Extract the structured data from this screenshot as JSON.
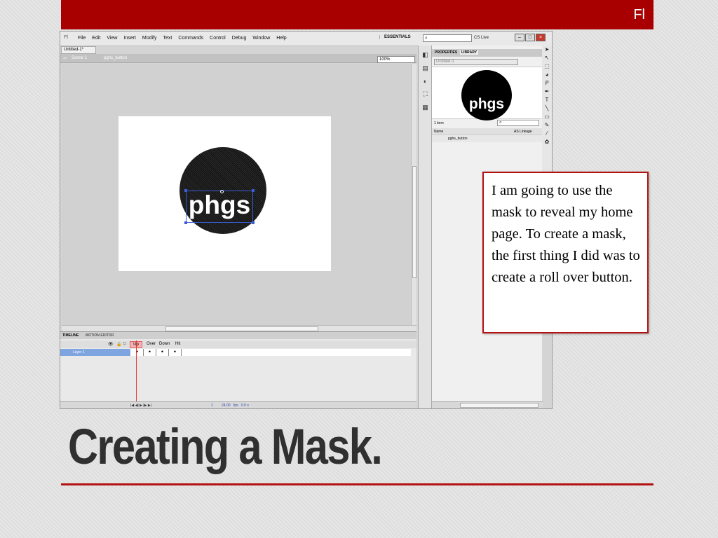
{
  "slide": {
    "corner_label": "Fl",
    "title": "Creating a Mask.",
    "note": "I am going to use the mask to reveal my home page. To create a mask, the first thing I did was to create a roll over button.",
    "accent": "#a80000"
  },
  "app": {
    "logo": "Fl",
    "menus": [
      "File",
      "Edit",
      "View",
      "Insert",
      "Modify",
      "Text",
      "Commands",
      "Control",
      "Debug",
      "Window",
      "Help"
    ],
    "workspace": "ESSENTIALS",
    "search_placeholder": "⌕",
    "cs_live": "CS Live",
    "doc_tab": "Untitled-1*",
    "breadcrumb": {
      "scene": "Scene 1",
      "symbol": "pghs_button"
    },
    "zoom": "100%",
    "stage_text": "phgs"
  },
  "timeline": {
    "tabs": [
      "TIMELINE",
      "MOTION EDITOR"
    ],
    "frames": [
      "Up",
      "Over",
      "Down",
      "Hit"
    ],
    "layer": "Layer 1",
    "fps": "24.00",
    "fps_unit": "fps",
    "time": "0.0 s",
    "frame_num": "1"
  },
  "library": {
    "tabs": [
      "PROPERTIES",
      "LIBRARY"
    ],
    "document": "Untitled-1",
    "preview_text": "phgs",
    "count": "1 item",
    "col_name": "Name",
    "col_linkage": "AS Linkage",
    "items": [
      "pghs_button"
    ]
  }
}
